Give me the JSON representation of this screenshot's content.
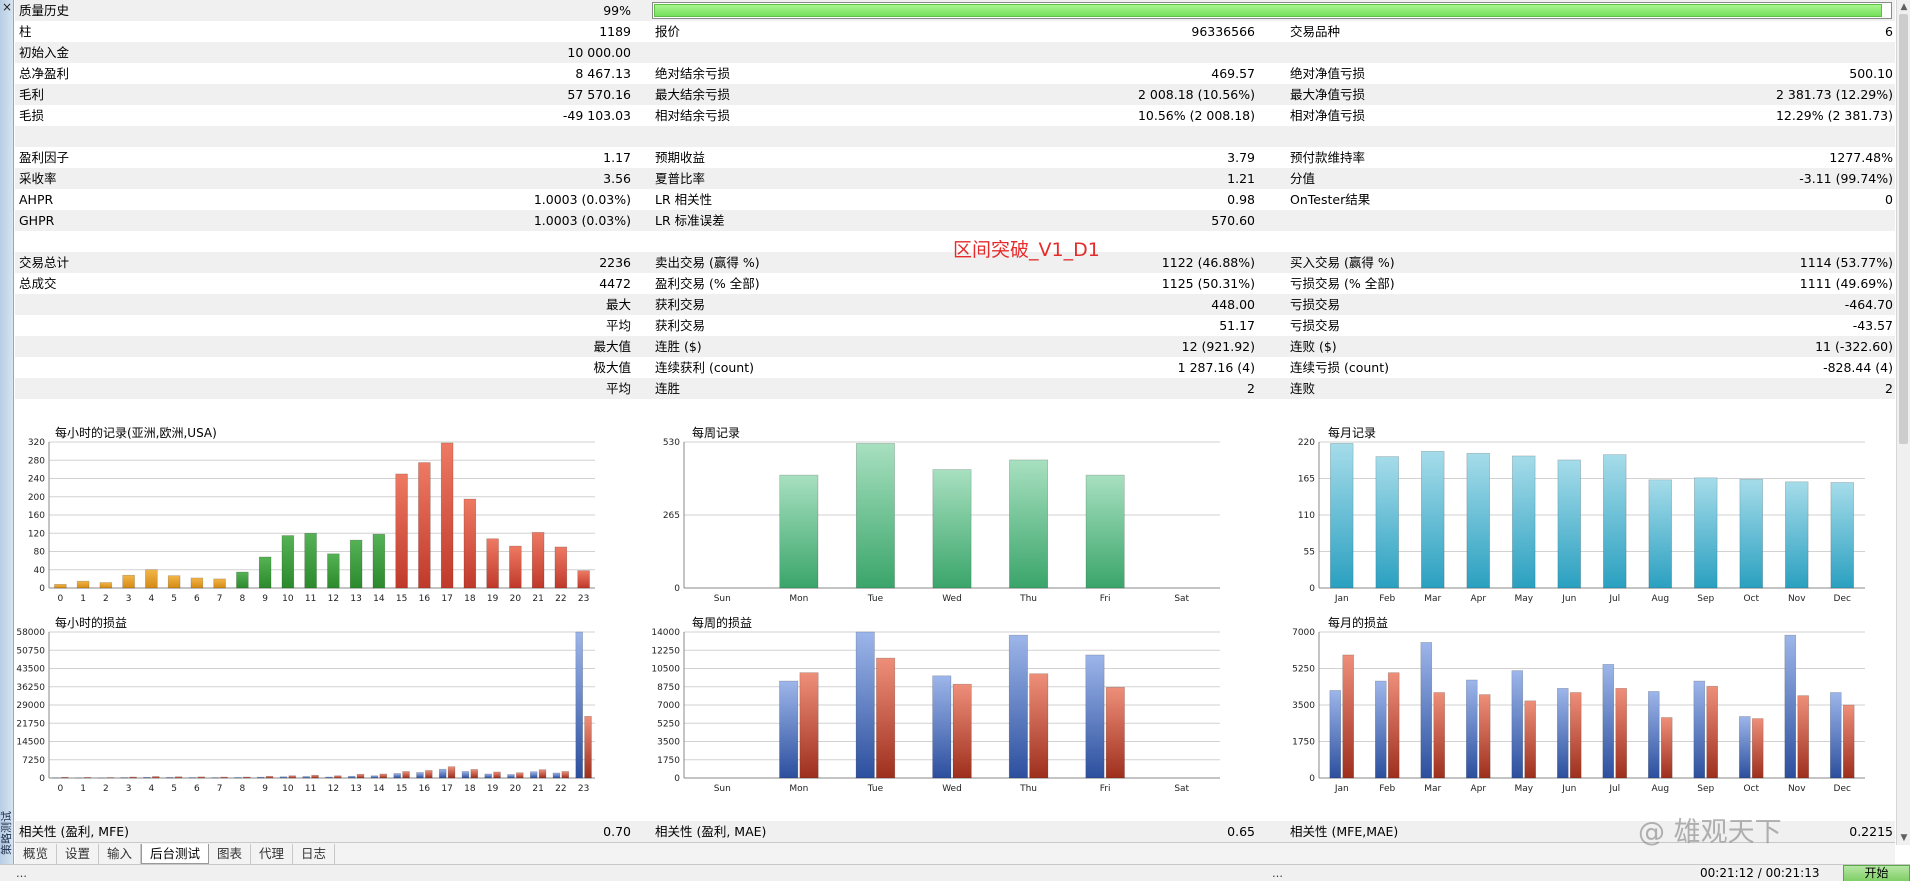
{
  "window": {
    "close_glyph": "×",
    "side_label": "策略测试"
  },
  "quality": {
    "label": "质量历史",
    "value": "99%",
    "progress": 0.995
  },
  "title": "区间突破_V1_D1",
  "rows": [
    {
      "shade": false,
      "c1": "柱",
      "c2": "1189",
      "c3": "报价",
      "c4": "96336566",
      "c5": "交易品种",
      "c6": "6"
    },
    {
      "shade": true,
      "c1": "初始入金",
      "c2": "10 000.00",
      "c3": "",
      "c4": "",
      "c5": "",
      "c6": ""
    },
    {
      "shade": false,
      "c1": "总净盈利",
      "c2": "8 467.13",
      "c3": "绝对结余亏损",
      "c4": "469.57",
      "c5": "绝对净值亏损",
      "c6": "500.10"
    },
    {
      "shade": true,
      "c1": "毛利",
      "c2": "57 570.16",
      "c3": "最大结余亏损",
      "c4": "2 008.18 (10.56%)",
      "c5": "最大净值亏损",
      "c6": "2 381.73 (12.29%)"
    },
    {
      "shade": false,
      "c1": "毛损",
      "c2": "-49 103.03",
      "c3": "相对结余亏损",
      "c4": "10.56% (2 008.18)",
      "c5": "相对净值亏损",
      "c6": "12.29% (2 381.73)"
    },
    {
      "shade": true,
      "c1": "",
      "c2": "",
      "c3": "",
      "c4": "",
      "c5": "",
      "c6": ""
    },
    {
      "shade": false,
      "c1": "盈利因子",
      "c2": "1.17",
      "c3": "预期收益",
      "c4": "3.79",
      "c5": "预付款维持率",
      "c6": "1277.48%"
    },
    {
      "shade": true,
      "c1": "采收率",
      "c2": "3.56",
      "c3": "夏普比率",
      "c4": "1.21",
      "c5": "分值",
      "c6": "-3.11 (99.74%)"
    },
    {
      "shade": false,
      "c1": "AHPR",
      "c2": "1.0003 (0.03%)",
      "c3": "LR 相关性",
      "c4": "0.98",
      "c5": "OnTester结果",
      "c6": "0"
    },
    {
      "shade": true,
      "c1": "GHPR",
      "c2": "1.0003 (0.03%)",
      "c3": "LR 标准误差",
      "c4": "570.60",
      "c5": "",
      "c6": ""
    },
    {
      "shade": false,
      "c1": "",
      "c2": "",
      "c3": "",
      "c4": "",
      "c5": "",
      "c6": ""
    },
    {
      "shade": true,
      "c1": "交易总计",
      "c2": "2236",
      "c3": "卖出交易 (赢得 %)",
      "c4": "1122 (46.88%)",
      "c5": "买入交易 (赢得 %)",
      "c6": "1114 (53.77%)"
    },
    {
      "shade": false,
      "c1": "总成交",
      "c2": "4472",
      "c3": "盈利交易 (% 全部)",
      "c4": "1125 (50.31%)",
      "c5": "亏损交易 (% 全部)",
      "c6": "1111 (49.69%)"
    },
    {
      "shade": true,
      "c1": "",
      "c2": "最大",
      "c3": "获利交易",
      "c4": "448.00",
      "c5": "亏损交易",
      "c6": "-464.70"
    },
    {
      "shade": false,
      "c1": "",
      "c2": "平均",
      "c3": "获利交易",
      "c4": "51.17",
      "c5": "亏损交易",
      "c6": "-43.57"
    },
    {
      "shade": true,
      "c1": "",
      "c2": "最大值",
      "c3": "连胜 ($)",
      "c4": "12 (921.92)",
      "c5": "连败 ($)",
      "c6": "11 (-322.60)"
    },
    {
      "shade": false,
      "c1": "",
      "c2": "极大值",
      "c3": "连续获利 (count)",
      "c4": "1 287.16 (4)",
      "c5": "连续亏损 (count)",
      "c6": "-828.44 (4)"
    },
    {
      "shade": true,
      "c1": "",
      "c2": "平均",
      "c3": "连胜",
      "c4": "2",
      "c5": "连败",
      "c6": "2"
    },
    {
      "shade": false,
      "c1": "",
      "c2": "",
      "c3": "",
      "c4": "",
      "c5": "",
      "c6": ""
    }
  ],
  "correlation": {
    "c1": "相关性 (盈利, MFE)",
    "c2": "0.70",
    "c3": "相关性 (盈利, MAE)",
    "c4": "0.65",
    "c5": "相关性 (MFE,MAE)",
    "c6": "0.2215"
  },
  "tabs": [
    {
      "label": "概览",
      "active": false
    },
    {
      "label": "设置",
      "active": false
    },
    {
      "label": "输入",
      "active": false
    },
    {
      "label": "后台测试",
      "active": true
    },
    {
      "label": "图表",
      "active": false
    },
    {
      "label": "代理",
      "active": false
    },
    {
      "label": "日志",
      "active": false
    }
  ],
  "status": {
    "left": "…",
    "mid": "…",
    "time": "00:21:12 / 00:21:13",
    "start_label": "开始"
  },
  "watermark": "@ 雄观天下",
  "colors": {
    "hour_orange": "#d58a14",
    "hour_green": "#2b8a2b",
    "hour_red": "#c0392b",
    "week_green": "#3aa56a",
    "month_teal": "#2aa0c0",
    "pl_blue": "#4a72c4",
    "pl_red": "#c0452e",
    "title_red": "#e52b2b",
    "quality_green": "#7fe066"
  },
  "chart_data": [
    {
      "type": "bar",
      "title": "每小时的记录(亚洲,欧洲,USA)",
      "categories": [
        "0",
        "1",
        "2",
        "3",
        "4",
        "5",
        "6",
        "7",
        "8",
        "9",
        "10",
        "11",
        "12",
        "13",
        "14",
        "15",
        "16",
        "17",
        "18",
        "19",
        "20",
        "21",
        "22",
        "23"
      ],
      "values": [
        8,
        15,
        12,
        28,
        40,
        27,
        22,
        20,
        35,
        68,
        115,
        120,
        75,
        105,
        118,
        250,
        275,
        318,
        195,
        108,
        92,
        122,
        90,
        38
      ],
      "ylim": [
        0,
        320
      ],
      "yticks": [
        "0",
        "40",
        "80",
        "120",
        "160",
        "200",
        "240",
        "280",
        "320"
      ],
      "grid": true
    },
    {
      "type": "bar",
      "title": "每周记录",
      "categories": [
        "Sun",
        "Mon",
        "Tue",
        "Wed",
        "Thu",
        "Fri",
        "Sat"
      ],
      "values": [
        0,
        410,
        525,
        430,
        465,
        410,
        0
      ],
      "ylim": [
        0,
        530
      ],
      "yticks": [
        "0",
        "265",
        "530"
      ],
      "grid": true
    },
    {
      "type": "bar",
      "title": "每月记录",
      "categories": [
        "Jan",
        "Feb",
        "Mar",
        "Apr",
        "May",
        "Jun",
        "Jul",
        "Aug",
        "Sep",
        "Oct",
        "Nov",
        "Dec"
      ],
      "values": [
        218,
        198,
        206,
        203,
        199,
        193,
        201,
        163,
        166,
        164,
        160,
        159
      ],
      "ylim": [
        0,
        220
      ],
      "yticks": [
        "0",
        "55",
        "110",
        "165",
        "220"
      ],
      "grid": true
    },
    {
      "type": "bar",
      "title": "每小时的损益",
      "categories": [
        "0",
        "1",
        "2",
        "3",
        "4",
        "5",
        "6",
        "7",
        "8",
        "9",
        "10",
        "11",
        "12",
        "13",
        "14",
        "15",
        "16",
        "17",
        "18",
        "19",
        "20",
        "21",
        "22",
        "23"
      ],
      "series": [
        {
          "values": [
            120,
            100,
            90,
            200,
            300,
            250,
            200,
            180,
            220,
            350,
            500,
            600,
            400,
            700,
            900,
            1800,
            2200,
            3500,
            2600,
            1600,
            1400,
            2500,
            2000,
            58000
          ]
        },
        {
          "values": [
            300,
            250,
            200,
            400,
            600,
            500,
            450,
            380,
            400,
            700,
            900,
            1100,
            900,
            1500,
            1600,
            2600,
            3000,
            4500,
            3400,
            2400,
            2100,
            3300,
            2600,
            24500
          ]
        }
      ],
      "ylim": [
        0,
        58000
      ],
      "yticks": [
        "0",
        "7250",
        "14500",
        "21750",
        "29000",
        "36250",
        "43500",
        "50750",
        "58000"
      ],
      "grid": true
    },
    {
      "type": "bar",
      "title": "每周的损益",
      "categories": [
        "Sun",
        "Mon",
        "Tue",
        "Wed",
        "Thu",
        "Fri",
        "Sat"
      ],
      "series": [
        {
          "values": [
            0,
            9300,
            14000,
            9800,
            13700,
            11800,
            0
          ]
        },
        {
          "values": [
            0,
            10100,
            11500,
            9000,
            10000,
            8700,
            0
          ]
        }
      ],
      "ylim": [
        0,
        14000
      ],
      "yticks": [
        "0",
        "1750",
        "3500",
        "5250",
        "7000",
        "8750",
        "10500",
        "12250",
        "14000"
      ],
      "grid": true
    },
    {
      "type": "bar",
      "title": "每月的损益",
      "categories": [
        "Jan",
        "Feb",
        "Mar",
        "Apr",
        "May",
        "Jun",
        "Jul",
        "Aug",
        "Sep",
        "Oct",
        "Nov",
        "Dec"
      ],
      "series": [
        {
          "values": [
            4200,
            4650,
            6500,
            4700,
            5150,
            4300,
            5450,
            4150,
            4650,
            2950,
            6850,
            4100
          ]
        },
        {
          "values": [
            5900,
            5050,
            4100,
            4000,
            3700,
            4100,
            4300,
            2900,
            4400,
            2850,
            3950,
            3500
          ]
        }
      ],
      "ylim": [
        0,
        7000
      ],
      "yticks": [
        "0",
        "1750",
        "3500",
        "5250",
        "7000"
      ],
      "grid": true
    }
  ]
}
